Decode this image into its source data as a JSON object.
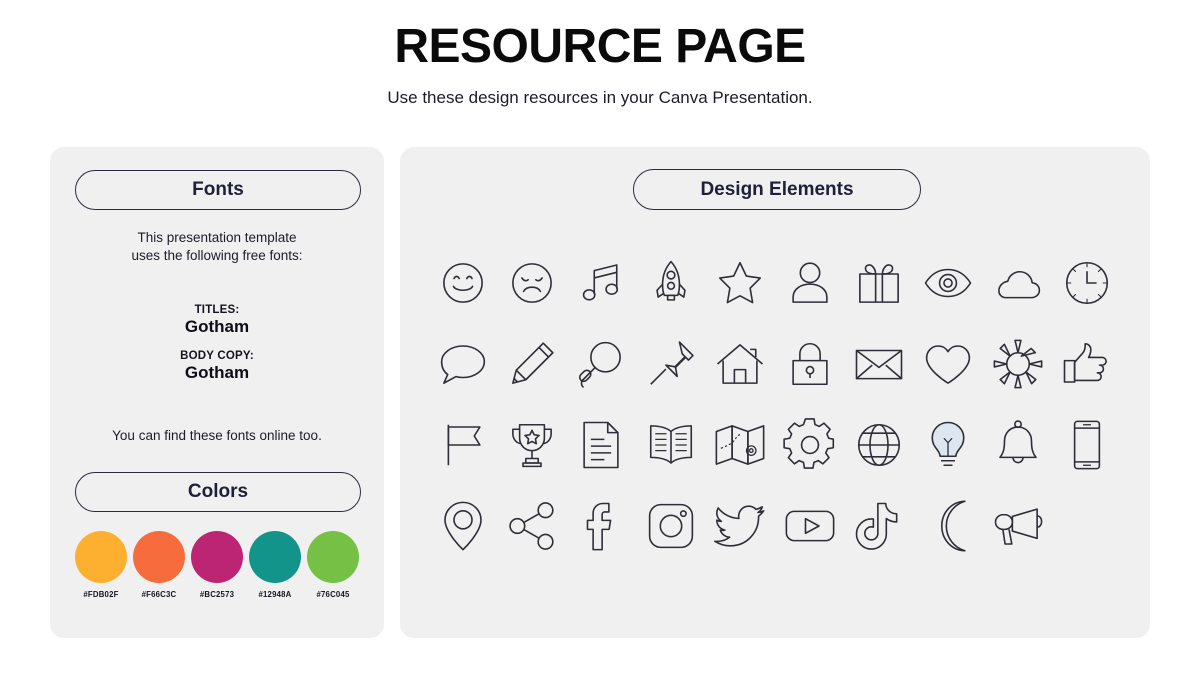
{
  "header": {
    "title": "RESOURCE PAGE",
    "subtitle": "Use these design resources in your Canva Presentation."
  },
  "fonts_panel": {
    "heading": "Fonts",
    "intro_line1": "This presentation template",
    "intro_line2": "uses the following free fonts:",
    "titles_label": "TITLES:",
    "titles_value": "Gotham",
    "body_label": "BODY COPY:",
    "body_value": "Gotham",
    "online_note": "You can find these fonts online too."
  },
  "colors_panel": {
    "heading": "Colors",
    "swatches": [
      {
        "code": "#FDB02F",
        "hex": "#FDB02F"
      },
      {
        "code": "#F66C3C",
        "hex": "#F66C3C"
      },
      {
        "code": "#BC2573",
        "hex": "#BC2573"
      },
      {
        "code": "#12948A",
        "hex": "#12948A"
      },
      {
        "code": "#76C045",
        "hex": "#76C045"
      }
    ]
  },
  "design_panel": {
    "heading": "Design Elements",
    "icons": [
      "smiley-face-icon",
      "sad-face-icon",
      "music-note-icon",
      "rocket-icon",
      "star-icon",
      "person-icon",
      "gift-icon",
      "eye-icon",
      "cloud-icon",
      "clock-icon",
      "speech-bubble-icon",
      "pencil-icon",
      "magnifier-icon",
      "pushpin-icon",
      "house-icon",
      "lock-icon",
      "envelope-icon",
      "heart-icon",
      "sun-icon",
      "thumbs-up-icon",
      "flag-icon",
      "trophy-icon",
      "document-icon",
      "book-icon",
      "map-icon",
      "gear-icon",
      "globe-icon",
      "lightbulb-icon",
      "bell-icon",
      "phone-icon",
      "location-pin-icon",
      "share-icon",
      "facebook-icon",
      "instagram-icon",
      "twitter-icon",
      "youtube-icon",
      "tiktok-icon",
      "moon-icon",
      "megaphone-icon"
    ]
  },
  "theme": {
    "panel_bg": "#F0F0F0",
    "page_bg": "#FFFFFF",
    "ink": "#1C1C28",
    "pill_border": "#2B2B3D",
    "icon_stroke": "#2E2E38",
    "bulb_fill": "#DCE7F2"
  }
}
